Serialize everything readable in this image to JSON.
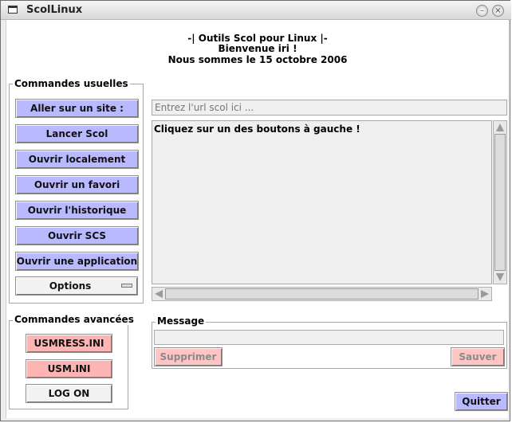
{
  "window": {
    "title": "ScolLinux",
    "minimize_icon": "minimize-icon",
    "close_icon": "close-icon"
  },
  "header": {
    "line1": "-| Outils Scol pour Linux |-",
    "line2": "Bienvenue iri !",
    "line3": "Nous sommes le 15 octobre 2006"
  },
  "usual": {
    "legend": "Commandes usuelles",
    "buttons": [
      "Aller sur un site :",
      "Lancer Scol",
      "Ouvrir localement",
      "Ouvrir un favori",
      "Ouvrir l'historique",
      "Ouvrir SCS",
      "Ouvrir une application"
    ],
    "options_label": "Options"
  },
  "advanced": {
    "legend": "Commandes avancées",
    "buttons": [
      "USMRESS.INI",
      "USM.INI",
      "LOG ON"
    ]
  },
  "url_field": {
    "placeholder": "Entrez l'url scol ici ..."
  },
  "output": {
    "text": "Cliquez sur un des boutons à gauche !"
  },
  "message": {
    "legend": "Message",
    "value": "",
    "delete_label": "Supprimer",
    "save_label": "Sauver"
  },
  "quit_label": "Quitter",
  "colors": {
    "blue_button": "#b9b9ff",
    "pink_button": "#ffb4b4",
    "window_bg": "#ffffff"
  }
}
